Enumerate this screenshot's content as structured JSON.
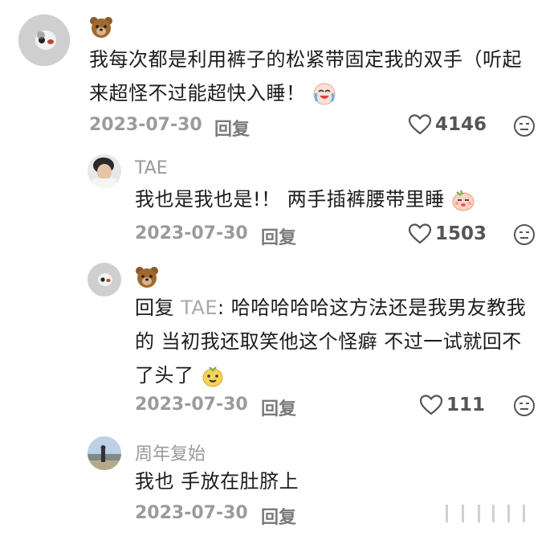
{
  "comments": [
    {
      "text": "我每次都是利用裤子的松紧带固定我的双手（听起来超怪不过能超快入睡！",
      "line1": "我每次都是利用裤子的松紧带固定我的双手（听起",
      "line2": "来超怪不过能超快入睡！",
      "date": "2023-07-30",
      "reply_label": "回复",
      "likes": "4146"
    },
    {
      "name": "TAE",
      "text": "我也是我也是!！ 两手插裤腰带里睡",
      "date": "2023-07-30",
      "reply_label": "回复",
      "likes": "1503"
    },
    {
      "reply_prefix": "回复",
      "mention": "TAE",
      "line1": "哈哈哈哈哈这方法还是我男友教我",
      "line2": "的 当初我还取笑他这个怪癖 不过一试就回不",
      "line3": "了头了",
      "date": "2023-07-30",
      "reply_label": "回复",
      "likes": "111"
    },
    {
      "name": "周年复始",
      "text": "我也  手放在肚脐上",
      "date": "2023-07-30",
      "reply_label": "回复"
    }
  ],
  "icons": {
    "like": "heart-outline-icon",
    "dislike": "neutral-face-icon",
    "bear": "bear-emoji",
    "crying_laugh": "crying-laughing-emoji",
    "sleepy": "sleepy-emoji"
  }
}
